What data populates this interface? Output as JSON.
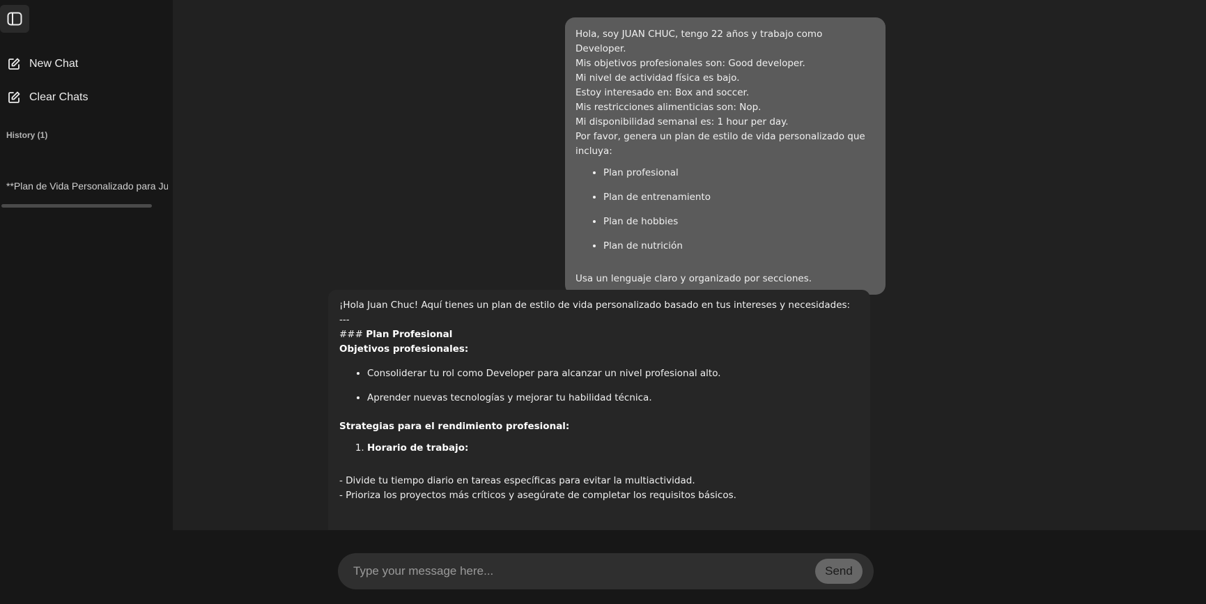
{
  "sidebar": {
    "new_chat": "New Chat",
    "clear_chats": "Clear Chats",
    "history_title": "History (1)",
    "history_items": [
      "**Plan de Vida Personalizado para Juan Chuc"
    ]
  },
  "user_message": {
    "lines": [
      "Hola, soy JUAN CHUC, tengo 22 años y trabajo como Developer.",
      "Mis objetivos profesionales son: Good developer.",
      "Mi nivel de actividad física es bajo.",
      "Estoy interesado en: Box and soccer.",
      "Mis restricciones alimenticias son: Nop.",
      "Mi disponibilidad semanal es: 1 hour per day.",
      "Por favor, genera un plan de estilo de vida personalizado que incluya:"
    ],
    "items": [
      "Plan profesional",
      "Plan de entrenamiento",
      "Plan de hobbies",
      "Plan de nutrición"
    ],
    "closing": "Usa un lenguaje claro y organizado por secciones."
  },
  "bot_message": {
    "intro": "¡Hola Juan Chuc! Aquí tienes un plan de estilo de vida personalizado basado en tus intereses y necesidades:",
    "separator": "---",
    "heading_prefix": "### ",
    "heading": "Plan Profesional",
    "objectives_label": "Objetivos profesionales:",
    "objectives": [
      "Consoliderar tu rol como Developer para alcanzar un nivel profesional alto.",
      "Aprender nuevas tecnologías y mejorar tu habilidad técnica."
    ],
    "strategies_label": "Strategias para el rendimiento profesional:",
    "ordered_item": "Horario de trabajo:",
    "details": [
      "- Divide tu tiempo diario en tareas específicas para evitar la multiactividad.",
      "- Prioriza los proyectos más críticos y asegúrate de completar los requisitos básicos."
    ]
  },
  "composer": {
    "placeholder": "Type your message here...",
    "send_label": "Send"
  }
}
